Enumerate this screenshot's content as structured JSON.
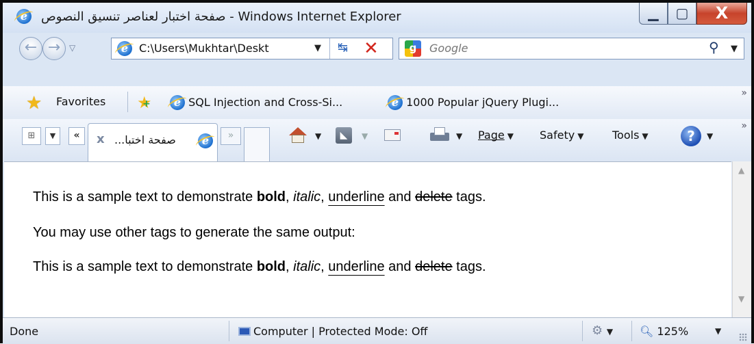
{
  "window": {
    "title": "صفحة اختبار لعناصر تنسيق النصوص - Windows Internet Explorer",
    "minimize_glyph": "▁",
    "maximize_glyph": "▢",
    "close_glyph": "X"
  },
  "address_bar": {
    "url": "C:\\Users\\Mukhtar\\Deskt",
    "search_placeholder": "Google"
  },
  "favorites_bar": {
    "favorites_label": "Favorites",
    "links": [
      "SQL Injection and Cross-Si...",
      "1000 Popular jQuery Plugi..."
    ]
  },
  "command_bar": {
    "tab_label": "...صفحة اختبا",
    "tabs_left_glyph": "«",
    "tabs_right_glyph": "»",
    "page_label": "Page",
    "safety_label": "Safety",
    "tools_label": "Tools"
  },
  "content": {
    "line1": {
      "prefix": "This is a sample text to demonstrate ",
      "bold": "bold",
      "sep1": ", ",
      "italic": "italic",
      "sep2": ", ",
      "underline": "underline",
      "and": " and ",
      "delete": "delete",
      "suffix": " tags."
    },
    "line2": "You may use other tags to generate the same output:",
    "line3": {
      "prefix": "This is a sample text to demonstrate ",
      "bold": "bold",
      "sep1": ", ",
      "italic": "italic",
      "sep2": ", ",
      "underline": "underline",
      "and": " and ",
      "delete": "delete",
      "suffix": " tags."
    }
  },
  "status_bar": {
    "status": "Done",
    "zone": "Computer | Protected Mode: Off",
    "zoom": "125%"
  },
  "icons": [
    "ie-icon",
    "back-icon",
    "forward-icon",
    "refresh-icon",
    "stop-icon",
    "google-icon",
    "search-icon",
    "favorites-star-icon",
    "add-favorites-icon",
    "home-icon",
    "rss-icon",
    "mail-icon",
    "print-icon",
    "help-icon",
    "computer-icon",
    "addons-icon",
    "zoom-icon"
  ],
  "colors": {
    "frame": "#dbe6f4",
    "close_button": "#c7432b",
    "link_ie_blue": "#1d6fcf"
  }
}
